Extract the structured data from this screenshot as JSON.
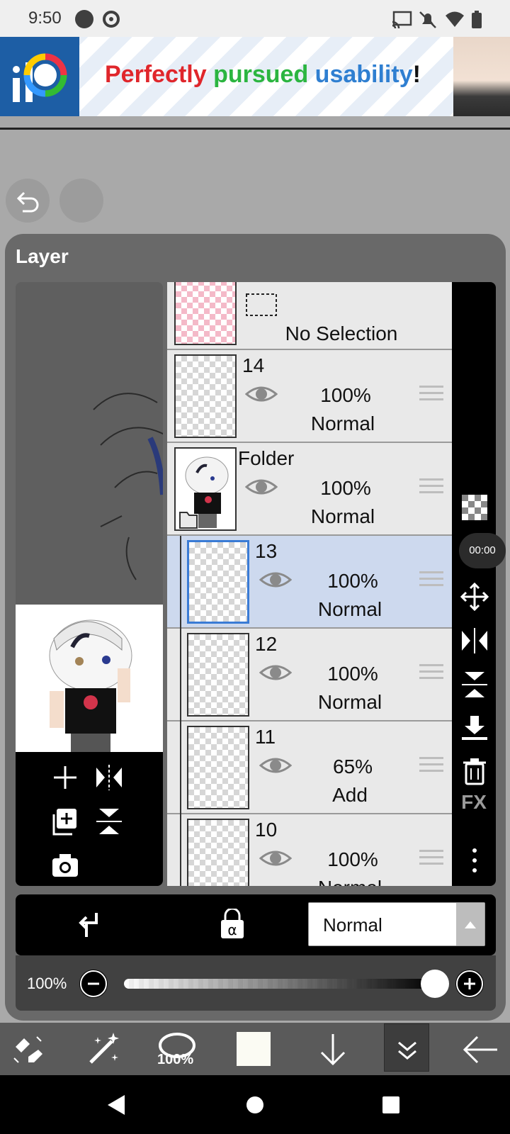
{
  "status_bar": {
    "time": "9:50"
  },
  "ad": {
    "headline_words": [
      "Perfectly",
      "pursued",
      "usability",
      "!"
    ],
    "headline_colors": [
      "#e0262b",
      "#2bb540",
      "#2f7fd1",
      "#111111"
    ]
  },
  "panel": {
    "title": "Layer"
  },
  "layers": [
    {
      "name": "",
      "opacity": "",
      "blend": "No Selection",
      "type": "selection-layer"
    },
    {
      "name": "14",
      "opacity": "100%",
      "blend": "Normal"
    },
    {
      "name": "Folder",
      "opacity": "100%",
      "blend": "Normal",
      "type": "folder"
    },
    {
      "name": "13",
      "opacity": "100%",
      "blend": "Normal",
      "selected": true
    },
    {
      "name": "12",
      "opacity": "100%",
      "blend": "Normal"
    },
    {
      "name": "11",
      "opacity": "65%",
      "blend": "Add"
    },
    {
      "name": "10",
      "opacity": "100%",
      "blend": "Normal"
    }
  ],
  "timer": "00:00",
  "side_toolbar": {
    "fx_label": "FX"
  },
  "blend_mode": {
    "selected": "Normal"
  },
  "opacity": {
    "label": "100%",
    "value": 1.0
  },
  "bottom_toolbar": {
    "lasso_label": "100%",
    "current_color": "#fbfbf3"
  },
  "colors": {
    "selected_row": "#cdd9ee",
    "accent_blue": "#3a7bd5",
    "panel_bg": "#696969"
  }
}
